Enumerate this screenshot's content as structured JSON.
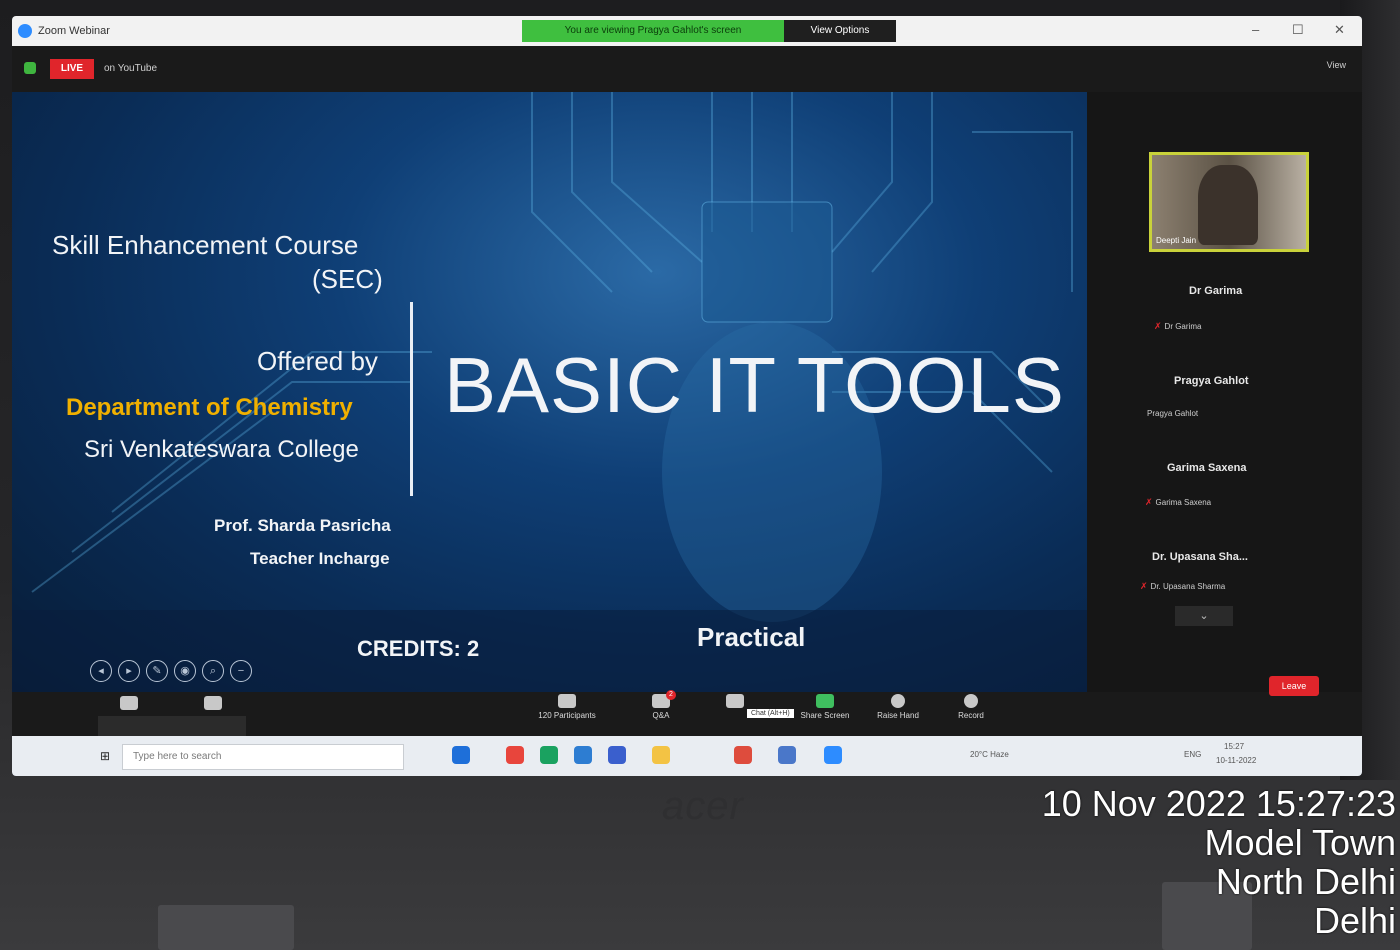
{
  "window": {
    "app_title": "Zoom Webinar",
    "share_banner": "You are viewing Pragya Gahlot's screen",
    "view_options": "View Options",
    "minimize": "–",
    "maximize": "☐",
    "close": "✕"
  },
  "meeting_top": {
    "live_label": "LIVE",
    "live_platform": "on YouTube",
    "view_label": "View"
  },
  "slide": {
    "course_line1": "Skill Enhancement Course",
    "course_line2": "(SEC)",
    "offered_by": "Offered by",
    "department": "Department of Chemistry",
    "college": "Sri Venkateswara College",
    "title": "BASIC IT TOOLS",
    "professor": "Prof. Sharda Pasricha",
    "role": "Teacher Incharge",
    "credits": "CREDITS: 2",
    "mode": "Practical"
  },
  "panel": {
    "video_tile_name": "Deepti Jain",
    "participants": [
      {
        "name": "Dr Garima",
        "sub": "Dr Garima",
        "muted": true
      },
      {
        "name": "Pragya Gahlot",
        "sub": "Pragya Gahlot",
        "muted": false
      },
      {
        "name": "Garima Saxena",
        "sub": "Garima Saxena",
        "muted": true
      },
      {
        "name": "Dr. Upasana Sha...",
        "sub": "Dr. Upasana Sharma",
        "muted": true
      }
    ],
    "scroll_down": "⌄"
  },
  "toolbar": {
    "participants_count": "120",
    "participants_label": "Participants",
    "qa_label": "Q&A",
    "qa_badge": "2",
    "chat_tooltip": "Chat (Alt+H)",
    "share_label": "Share Screen",
    "raise_hand_label": "Raise Hand",
    "record_label": "Record",
    "leave_label": "Leave"
  },
  "taskbar": {
    "search_placeholder": "Type here to search",
    "weather": "20°C Haze",
    "language": "ENG",
    "time": "15:27",
    "date": "10-11-2022"
  },
  "laptop": {
    "brand": "acer"
  },
  "photo_stamp": {
    "datetime": "10 Nov 2022 15:27:23",
    "line2": "Model Town",
    "line3": "North Delhi",
    "line4": "Delhi"
  },
  "colors": {
    "live_red": "#e0252b",
    "share_green": "#3fbf3f",
    "department_gold": "#f0b000",
    "slide_blue": "#0f3f76"
  }
}
